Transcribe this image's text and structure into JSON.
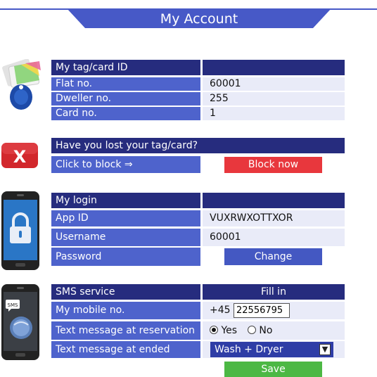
{
  "page": {
    "title": "My Account"
  },
  "card_section": {
    "header": "My tag/card ID",
    "rows": [
      {
        "label": "Flat no.",
        "value": "60001"
      },
      {
        "label": "Dweller no.",
        "value": "255"
      },
      {
        "label": "Card no.",
        "value": "1"
      }
    ]
  },
  "lost_section": {
    "header": "Have you lost your tag/card?",
    "click_label": "Click to block ⇒",
    "block_button": "Block now"
  },
  "login_section": {
    "header": "My login",
    "rows": [
      {
        "label": "App ID",
        "value": "VUXRWXOTTXOR"
      },
      {
        "label": "Username",
        "value": "60001"
      },
      {
        "label": "Password",
        "button": "Change"
      }
    ]
  },
  "sms_section": {
    "header": "SMS service",
    "header_right": "Fill in",
    "mobile_label": "My mobile no.",
    "country_code": "+45",
    "mobile_value": "22556795",
    "reservation_label": "Text message at reservation",
    "radio_yes": "Yes",
    "radio_no": "No",
    "radio_selected": "Yes",
    "ended_label": "Text message at ended",
    "ended_selected": "Wash + Dryer",
    "save_button": "Save"
  },
  "icons": {
    "card": "tag-card-icon",
    "lost": "red-x-icon",
    "login": "phone-lock-icon",
    "sms": "phone-sms-icon"
  },
  "colors": {
    "header_bg": "#262c7e",
    "label_bg": "#4e63cc",
    "value_bg": "#e9ebf8",
    "block_red": "#e8373d",
    "change_blue": "#4458c2",
    "save_green": "#4cb844"
  }
}
